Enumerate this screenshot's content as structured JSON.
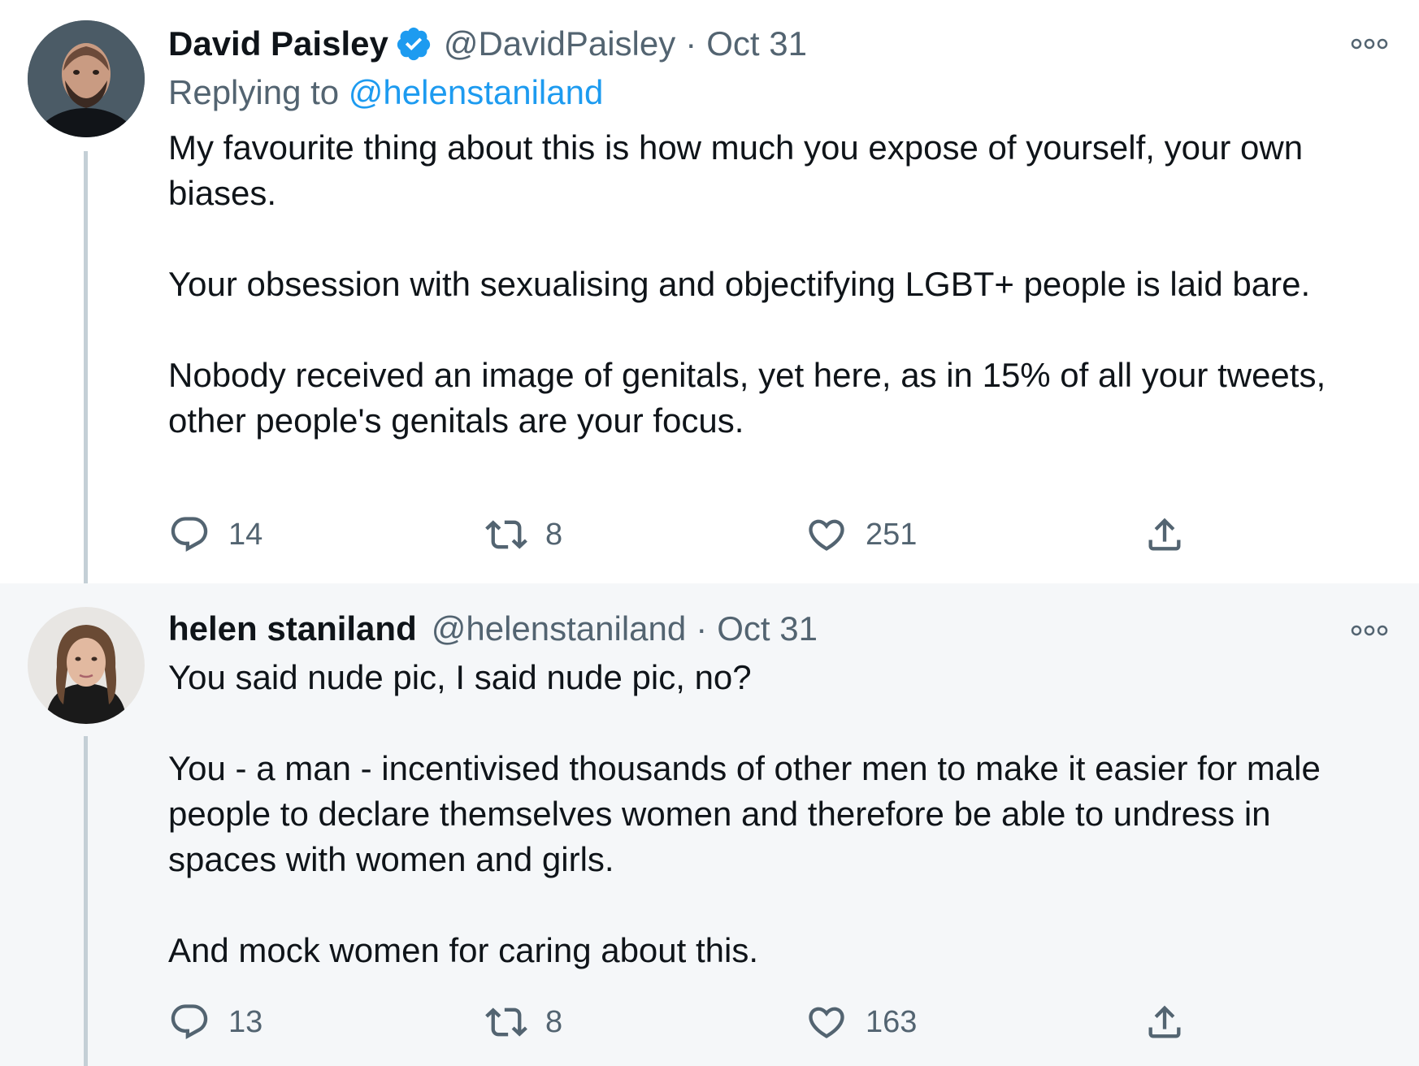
{
  "tweets": [
    {
      "display_name": "David Paisley",
      "verified": true,
      "handle": "@DavidPaisley",
      "separator": "·",
      "date": "Oct 31",
      "replying_to_label": "Replying to",
      "replying_to_handle": "@helenstaniland",
      "paragraphs": [
        "My favourite thing about this is how much you expose of yourself, your own biases.",
        "Your obsession with sexualising and objectifying LGBT+ people is laid bare.",
        "Nobody received an image of genitals, yet here, as in 15% of all your tweets, other people's genitals are your focus."
      ],
      "replies": "14",
      "retweets": "8",
      "likes": "251",
      "icons": [
        "avatar",
        "verified-badge-icon",
        "more-icon",
        "reply-icon",
        "retweet-icon",
        "like-icon",
        "share-icon"
      ]
    },
    {
      "display_name": "helen staniland",
      "verified": false,
      "handle": "@helenstaniland",
      "separator": "·",
      "date": "Oct 31",
      "paragraphs": [
        "You said nude pic, I said nude pic, no?",
        "You - a man - incentivised thousands of other men to make it easier for male people to declare themselves women and therefore be able to undress in spaces with women and girls.",
        "And mock women for caring about this."
      ],
      "replies": "13",
      "retweets": "8",
      "likes": "163",
      "icons": [
        "avatar",
        "more-icon",
        "reply-icon",
        "retweet-icon",
        "like-icon",
        "share-icon"
      ]
    }
  ],
  "colors": {
    "text": "#0f1419",
    "secondary": "#536471",
    "link": "#1d9bf0",
    "verified": "#1d9bf0",
    "thread_line": "#c4cfd6",
    "highlight_background": "#f5f7f9"
  }
}
